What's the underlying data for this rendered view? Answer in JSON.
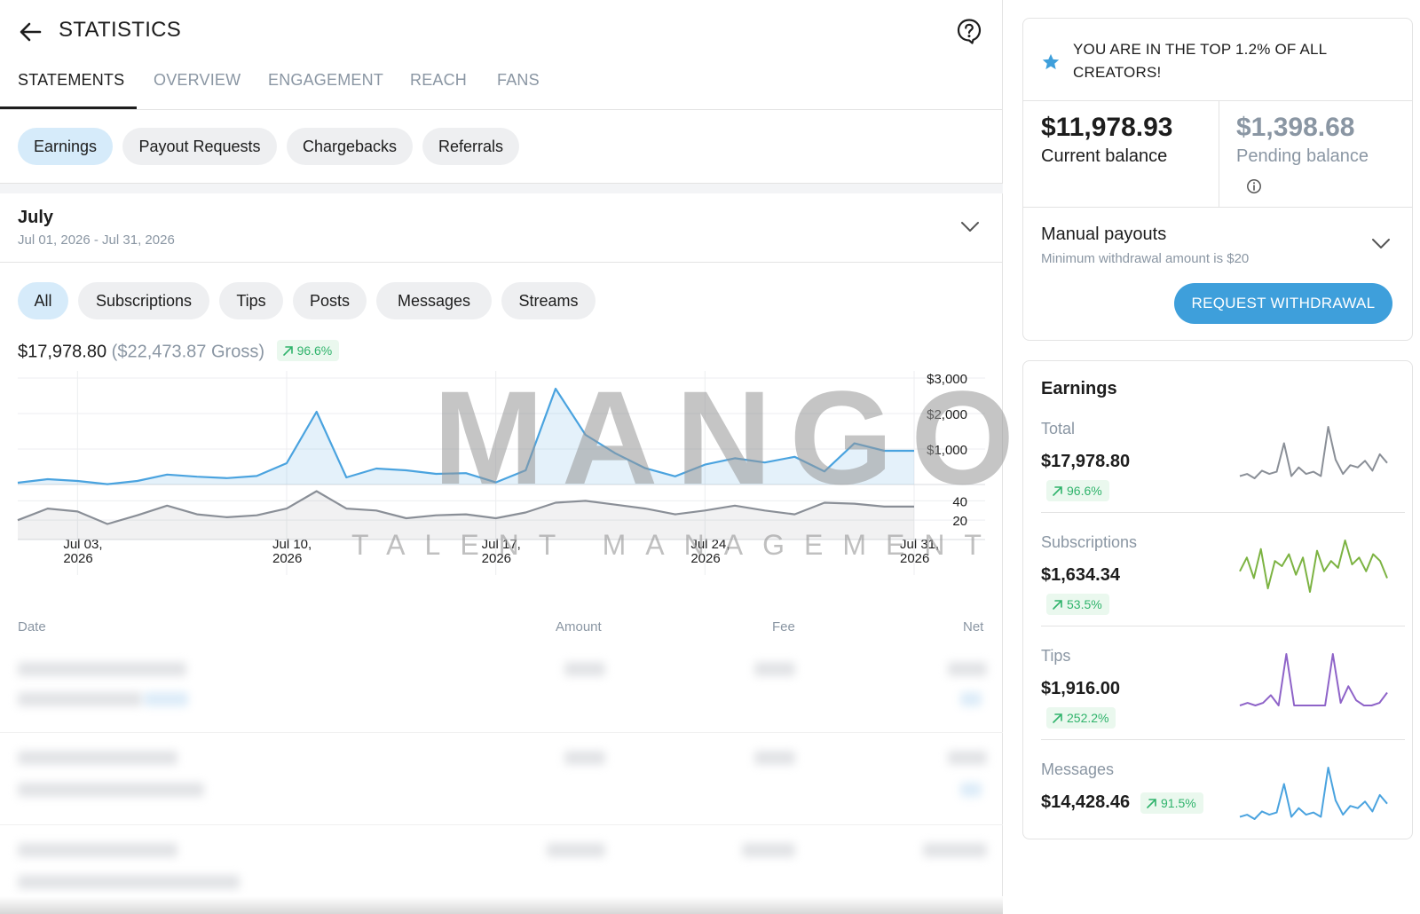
{
  "header": {
    "title": "STATISTICS"
  },
  "tabs": [
    {
      "label": "STATEMENTS",
      "active": true
    },
    {
      "label": "OVERVIEW"
    },
    {
      "label": "ENGAGEMENT"
    },
    {
      "label": "REACH"
    },
    {
      "label": "FANS"
    }
  ],
  "statement_types": [
    "Earnings",
    "Payout Requests",
    "Chargebacks",
    "Referrals"
  ],
  "period": {
    "title": "July",
    "range": "Jul 01, 2026 - Jul 31, 2026"
  },
  "filters": [
    "All",
    "Subscriptions",
    "Tips",
    "Posts",
    "Messages",
    "Streams"
  ],
  "summary": {
    "net": "$17,978.80",
    "gross": "($22,473.87 Gross)",
    "change": "96.6%"
  },
  "watermark": {
    "main": "MANGO",
    "sub": "TALENT MANAGEMENT"
  },
  "chart_data": {
    "type": "line",
    "x_ticks": [
      "Jul 03,\n2026",
      "Jul 10,\n2026",
      "Jul 17,\n2026",
      "Jul 24,\n2026",
      "Jul 31,\n2026"
    ],
    "x": [
      1,
      2,
      3,
      4,
      5,
      6,
      7,
      8,
      9,
      10,
      11,
      12,
      13,
      14,
      15,
      16,
      17,
      18,
      19,
      20,
      21,
      22,
      23,
      24,
      25,
      26,
      27,
      28,
      29,
      30,
      31
    ],
    "series": [
      {
        "values": [
          50,
          150,
          100,
          10,
          100,
          280,
          220,
          180,
          240,
          600,
          2050,
          200,
          450,
          400,
          300,
          320,
          60,
          400,
          2700,
          1400,
          880,
          460,
          230,
          560,
          740,
          620,
          780,
          370,
          1160,
          950,
          950
        ],
        "ylim": [
          0,
          3000
        ],
        "y_ticks": [
          "$3,000",
          "$2,000",
          "$1,000"
        ],
        "color": "#4aa3df"
      },
      {
        "values": [
          20,
          32,
          29,
          16,
          25,
          35,
          26,
          23,
          25,
          32,
          50,
          32,
          30,
          22,
          25,
          26,
          22,
          28,
          38,
          40,
          36,
          32,
          26,
          30,
          35,
          30,
          26,
          38,
          37,
          34,
          34
        ],
        "ylim": [
          0,
          55
        ],
        "y_ticks": [
          "40",
          "20"
        ],
        "color": "#8a8f97"
      }
    ]
  },
  "table": {
    "headers": {
      "date": "Date",
      "amount": "Amount",
      "fee": "Fee",
      "net": "Net"
    }
  },
  "creator_rank": {
    "text": "YOU ARE IN THE TOP 1.2% OF ALL CREATORS!"
  },
  "balances": {
    "current": {
      "amount": "$11,978.93",
      "label": "Current balance"
    },
    "pending": {
      "amount": "$1,398.68",
      "label": "Pending balance"
    }
  },
  "payouts": {
    "title": "Manual payouts",
    "subtitle": "Minimum withdrawal amount is $20",
    "button": "REQUEST WITHDRAWAL"
  },
  "earnings_card": {
    "title": "Earnings",
    "items": [
      {
        "label": "Total",
        "amount": "$17,978.80",
        "change": "96.6%",
        "color": "#8a8f97",
        "spark": [
          10,
          12,
          8,
          15,
          12,
          14,
          40,
          10,
          18,
          12,
          14,
          10,
          55,
          25,
          12,
          20,
          18,
          24,
          15,
          30,
          22
        ]
      },
      {
        "label": "Subscriptions",
        "amount": "$1,634.34",
        "change": "53.5%",
        "color": "#7cb342",
        "spark": [
          22,
          30,
          18,
          35,
          12,
          28,
          25,
          32,
          20,
          30,
          10,
          34,
          22,
          28,
          24,
          40,
          26,
          30,
          22,
          32,
          28,
          18
        ]
      },
      {
        "label": "Tips",
        "amount": "$1,916.00",
        "change": "252.2%",
        "color": "#8e63c8",
        "spark": [
          10,
          12,
          10,
          12,
          18,
          10,
          50,
          10,
          10,
          10,
          10,
          10,
          50,
          12,
          25,
          14,
          10,
          10,
          12,
          20
        ]
      },
      {
        "label": "Messages",
        "amount": "$14,428.46",
        "change": "91.5%",
        "color": "#4aa3df",
        "spark": [
          10,
          12,
          8,
          15,
          12,
          14,
          40,
          10,
          18,
          12,
          14,
          10,
          55,
          25,
          12,
          20,
          18,
          24,
          15,
          30,
          22
        ]
      }
    ]
  },
  "colors": {
    "accent": "#3e9fdb",
    "positive": "#2fb36b",
    "muted": "#8a96a3"
  }
}
